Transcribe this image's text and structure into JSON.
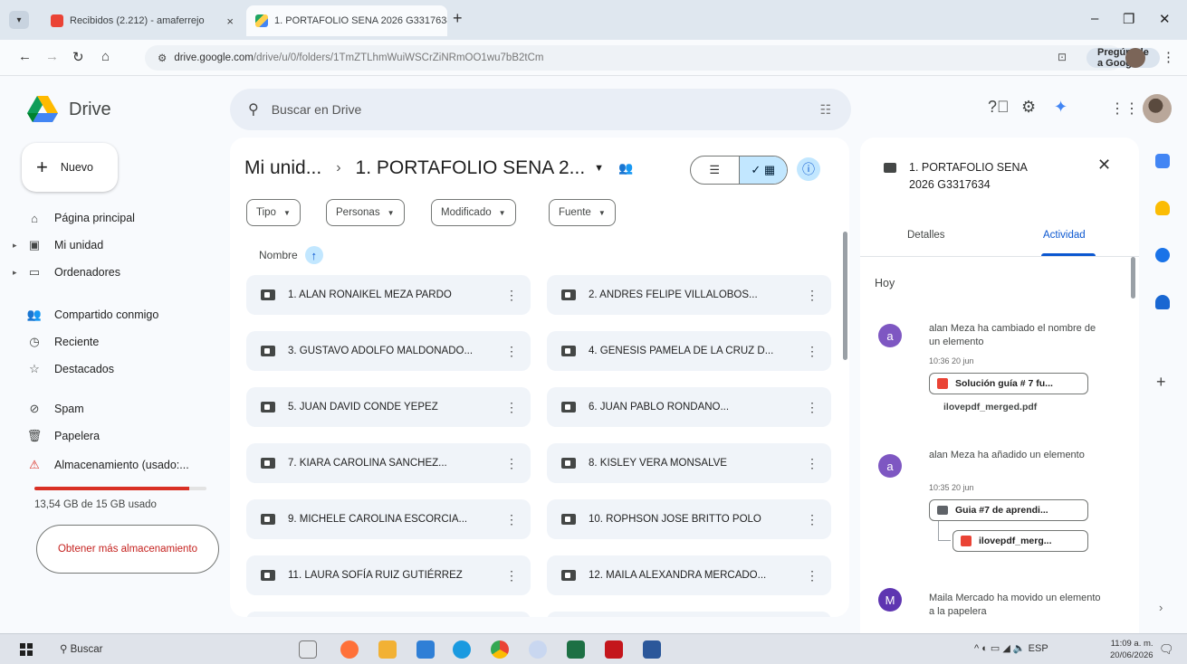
{
  "browser": {
    "tabs": [
      {
        "title": "Recibidos (2.212) - amaferrejo",
        "active": false
      },
      {
        "title": "1. PORTAFOLIO SENA 2026 G3317634",
        "active": true
      }
    ],
    "url_host": "drive.google.com",
    "url_path": "/drive/u/0/folders/1TmZTLhmWuiWSCrZiNRmOO1wu7bB2tCm",
    "ask_google": "Pregúntale a Google"
  },
  "app": {
    "name": "Drive",
    "search_placeholder": "Buscar en Drive"
  },
  "sidebar": {
    "new_label": "Nuevo",
    "items": [
      {
        "label": "Página principal",
        "icon": "home-icon"
      },
      {
        "label": "Mi unidad",
        "icon": "my-drive-icon"
      },
      {
        "label": "Ordenadores",
        "icon": "computer-icon"
      },
      {
        "label": "Compartido conmigo",
        "icon": "shared-icon"
      },
      {
        "label": "Reciente",
        "icon": "clock-icon"
      },
      {
        "label": "Destacados",
        "icon": "star-icon"
      },
      {
        "label": "Spam",
        "icon": "spam-icon"
      },
      {
        "label": "Papelera",
        "icon": "trash-icon"
      },
      {
        "label": "Almacenamiento (usado:...",
        "icon": "storage-warning-icon"
      }
    ],
    "storage_used_fraction": 0.9,
    "storage_text": "13,54 GB de 15 GB usado",
    "get_more_storage": "Obtener más almacenamiento"
  },
  "main": {
    "breadcrumb_root": "Mi unid...",
    "breadcrumb_current": "1. PORTAFOLIO SENA 2...",
    "filters": [
      "Tipo",
      "Personas",
      "Modificado",
      "Fuente"
    ],
    "sort_label": "Nombre",
    "folders": [
      "1. ALAN RONAIKEL MEZA PARDO",
      "2. ANDRES FELIPE VILLALOBOS...",
      "3. GUSTAVO ADOLFO MALDONADO...",
      "4. GENESIS PAMELA DE LA CRUZ D...",
      "5. JUAN DAVID CONDE YEPEZ",
      "6. JUAN PABLO RONDANO...",
      "7. KIARA CAROLINA SANCHEZ...",
      "8. KISLEY VERA MONSALVE",
      "9. MICHELE CAROLINA ESCORCIA...",
      "10. ROPHSON JOSE BRITTO POLO",
      "11. LAURA SOFÍA RUIZ GUTIÉRREZ",
      "12. MAILA ALEXANDRA MERCADO..."
    ]
  },
  "details": {
    "title_line1": "1. PORTAFOLIO SENA",
    "title_line2": "2026 G3317634",
    "tabs": [
      "Detalles",
      "Actividad"
    ],
    "day": "Hoy",
    "activities": [
      {
        "avatar": "a",
        "text": "alan Meza ha cambiado el nombre de un elemento",
        "time": "10:36 20 jun",
        "chip": "Solución guía # 7 fu...",
        "file": "ilovepdf_merged.pdf"
      },
      {
        "avatar": "a",
        "text": "alan Meza ha añadido un elemento",
        "time": "10:35 20 jun",
        "chip": "Guia #7 de aprendi...",
        "chip2": "ilovepdf_merg..."
      },
      {
        "avatar": "M",
        "text": "Maila Mercado ha movido un elemento a la papelera"
      }
    ]
  },
  "taskbar": {
    "search": "Buscar",
    "lang": "ESP",
    "time": "11:09 a. m.",
    "date": "20/06/2026"
  },
  "colors": {
    "accent_blue": "#0b57d0",
    "selected_bg": "#c2e7ff",
    "storage_red": "#d93025",
    "folder_card_bg": "#f0f4f9"
  }
}
